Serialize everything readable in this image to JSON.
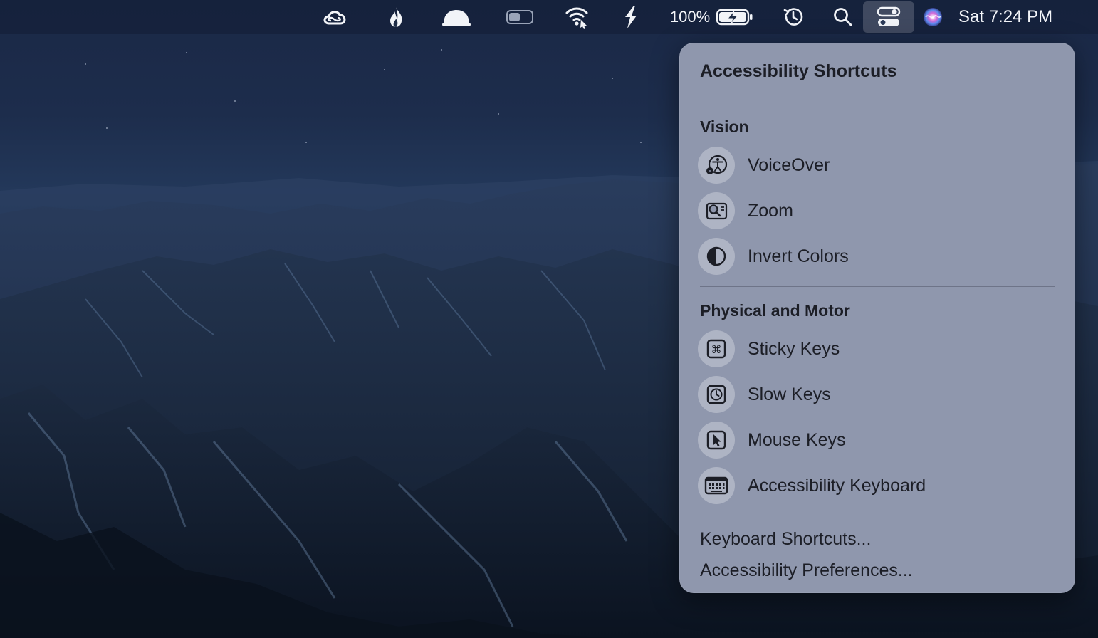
{
  "menubar": {
    "icons": [
      "creative-cloud-icon",
      "flame-icon",
      "cloud-icon",
      "toggle-switch-icon",
      "wifi-icon",
      "lightning-icon",
      "battery-charging-icon",
      "time-machine-icon",
      "spotlight-search-icon",
      "control-center-icon",
      "siri-icon"
    ],
    "battery_percent": "100%",
    "battery_level": 1.0,
    "clock": "Sat 7:24 PM"
  },
  "panel": {
    "title": "Accessibility Shortcuts",
    "sections": [
      {
        "title": "Vision",
        "items": [
          {
            "label": "VoiceOver",
            "icon": "voiceover-icon"
          },
          {
            "label": "Zoom",
            "icon": "zoom-icon"
          },
          {
            "label": "Invert Colors",
            "icon": "invert-colors-icon"
          }
        ]
      },
      {
        "title": "Physical and Motor",
        "items": [
          {
            "label": "Sticky Keys",
            "icon": "sticky-keys-icon"
          },
          {
            "label": "Slow Keys",
            "icon": "slow-keys-icon"
          },
          {
            "label": "Mouse Keys",
            "icon": "mouse-keys-icon"
          },
          {
            "label": "Accessibility Keyboard",
            "icon": "accessibility-keyboard-icon"
          }
        ]
      }
    ],
    "links": [
      {
        "label": "Keyboard Shortcuts..."
      },
      {
        "label": "Accessibility Preferences..."
      }
    ]
  },
  "colors": {
    "panel_bg": "#8f97ad",
    "panel_text": "#1c1e26",
    "menubar_text": "#f4f6fa"
  }
}
